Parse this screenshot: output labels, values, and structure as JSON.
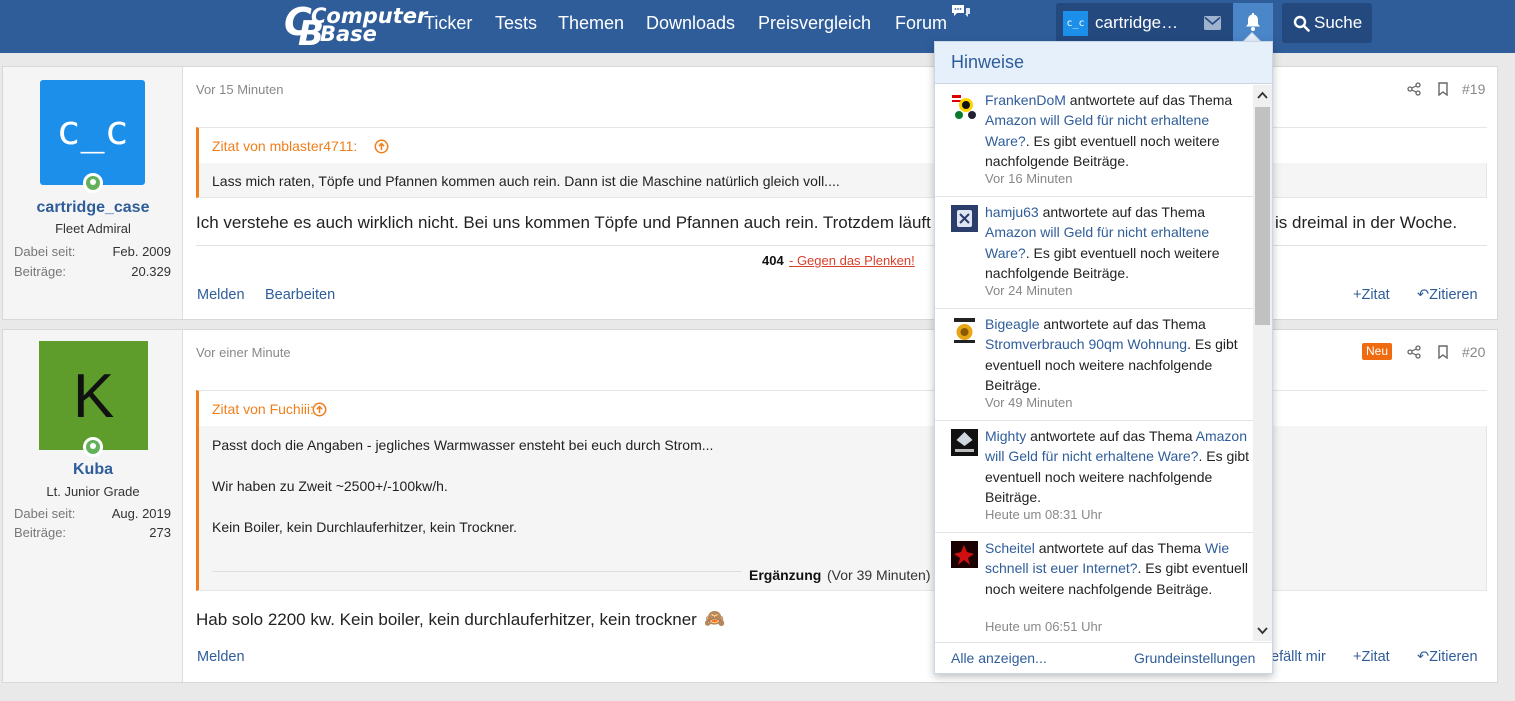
{
  "nav": {
    "logo_line1": "Computer",
    "logo_line2": "Base",
    "items": [
      "Ticker",
      "Tests",
      "Themen",
      "Downloads",
      "Preisvergleich",
      "Forum"
    ],
    "user_avatar_text": "c_c",
    "user_name": "cartridge…",
    "search_label": "Suche"
  },
  "posts": [
    {
      "author": "cartridge_case",
      "avatar_text": "c_c",
      "avatar_color": "#1c8fea",
      "user_title": "Fleet Admiral",
      "joined_label": "Dabei seit:",
      "joined": "Feb. 2009",
      "posts_label": "Beiträge:",
      "post_count": "20.329",
      "time": "Vor 15 Minuten",
      "number": "#19",
      "quote_author": "Zitat von mblaster4711:",
      "quote_lines": [
        "Lass mich raten, Töpfe und Pfannen kommen auch rein. Dann ist die Maschine natürlich gleich voll...."
      ],
      "body_left": "Ich verstehe es auch wirklich nicht. Bei uns kommen Töpfe und Pfannen auch rein. Trotzdem läuft di",
      "body_right": "is dreimal in der Woche.",
      "signature_bold": "404",
      "signature_link": " - Gegen das Plenken!",
      "actions_left": [
        "Melden",
        "Bearbeiten"
      ],
      "actions_right": [
        "Zitat",
        "Zitieren"
      ]
    },
    {
      "author": "Kuba",
      "avatar_text": "K",
      "avatar_color": "#5e9c2c",
      "user_title": "Lt. Junior Grade",
      "joined_label": "Dabei seit:",
      "joined": "Aug. 2019",
      "posts_label": "Beiträge:",
      "post_count": "273",
      "time": "Vor einer Minute",
      "badge": "Neu",
      "number": "#20",
      "quote_author": "Zitat von Fuchiii:",
      "quote_lines": [
        "Passt doch die Angaben - jegliches Warmwasser ensteht bei euch durch Strom...",
        "Wir haben zu Zweit ~2500+/-100kw/h.",
        "Kein Boiler, kein Durchlauferhitzer, kein Trockner."
      ],
      "supplement_bold": "Ergänzung",
      "supplement_time": "(Vor 39 Minuten)",
      "body_left": "Hab solo 2200 kw. Kein boiler, kein durchlauferhitzer, kein trockner",
      "emoji": "🙈",
      "actions_left": [
        "Melden"
      ],
      "like_partial": "efällt mir",
      "actions_right": [
        "Zitat",
        "Zitieren"
      ]
    }
  ],
  "notifications": {
    "title": "Hinweise",
    "items": [
      {
        "user": "FrankenDoM",
        "mid": " antwortete auf das Thema ",
        "thread": "Amazon will Geld für nicht erhaltene Ware?",
        "tail": ". Es gibt eventuell noch weitere nachfolgende Beiträge.",
        "time": "Vor 16 Minuten"
      },
      {
        "user": "hamju63",
        "mid": " antwortete auf das Thema ",
        "thread": "Amazon will Geld für nicht erhaltene Ware?",
        "tail": ". Es gibt eventuell noch weitere nachfolgende Beiträge.",
        "time": "Vor 24 Minuten"
      },
      {
        "user": "Bigeagle",
        "mid": " antwortete auf das Thema ",
        "thread": "Stromverbrauch 90qm Wohnung",
        "tail": ". Es gibt eventuell noch weitere nachfolgende Beiträge.",
        "time": "Vor 49 Minuten"
      },
      {
        "user": "Mighty",
        "mid": " antwortete auf das Thema ",
        "thread": "Amazon will Geld für nicht erhaltene Ware?",
        "tail": ". Es gibt eventuell noch weitere nachfolgende Beiträge.",
        "time": "Heute um 08:31 Uhr"
      },
      {
        "user": "Scheitel",
        "mid": " antwortete auf das Thema ",
        "thread": "Wie schnell ist euer Internet?",
        "tail": ". Es gibt eventuell noch weitere nachfolgende Beiträge.",
        "time": "Heute um 06:51 Uhr"
      }
    ],
    "show_all": "Alle anzeigen...",
    "settings": "Grundeinstellungen"
  },
  "colors": {
    "nav_bg": "#2f5d9a",
    "accent_orange": "#f07e1b",
    "link_blue": "#2f5d9a",
    "badge_new": "#f06a0f"
  }
}
